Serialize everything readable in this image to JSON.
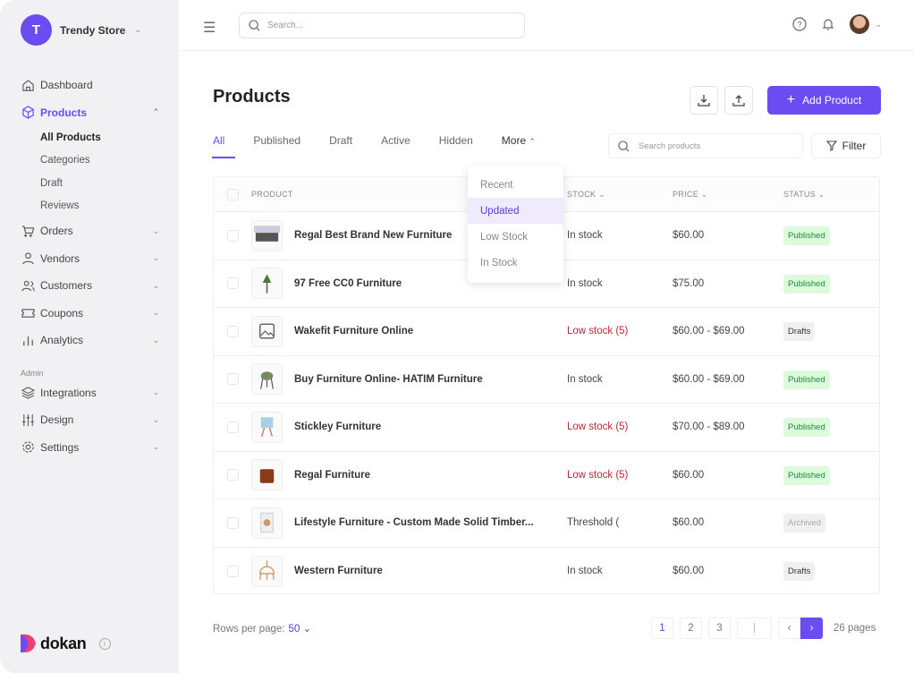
{
  "colors": {
    "accent": "#6a4cf0",
    "sidebar_bg": "#f1f1f4",
    "low_stock": "#b42a3c",
    "published_bg": "#dcfadc"
  },
  "store": {
    "initial": "T",
    "name": "Trendy Store"
  },
  "sidebar": {
    "items": [
      {
        "label": "Dashboard",
        "icon": "home-icon"
      },
      {
        "label": "Products",
        "icon": "box-icon",
        "active": true
      }
    ],
    "sub_items": [
      {
        "label": "All Products",
        "active": true
      },
      {
        "label": "Categories"
      },
      {
        "label": "Draft"
      },
      {
        "label": "Reviews"
      }
    ],
    "more_items": [
      {
        "label": "Orders",
        "icon": "cart-icon"
      },
      {
        "label": "Vendors",
        "icon": "user-icon"
      },
      {
        "label": "Customers",
        "icon": "users-icon"
      },
      {
        "label": "Coupons",
        "icon": "ticket-icon"
      },
      {
        "label": "Analytics",
        "icon": "bar-chart-icon"
      }
    ],
    "admin_label": "Admin",
    "admin_items": [
      {
        "label": "Integrations",
        "icon": "layers-icon"
      },
      {
        "label": "Design",
        "icon": "sliders-icon"
      },
      {
        "label": "Settings",
        "icon": "gear-icon"
      }
    ],
    "logo": "dokan"
  },
  "topbar": {
    "search_placeholder": "Search..."
  },
  "page": {
    "title": "Products",
    "add_label": "Add Product"
  },
  "tabs": [
    "All",
    "Published",
    "Draft",
    "Active",
    "Hidden",
    "More"
  ],
  "product_search_placeholder": "Search products",
  "filter_label": "Filter",
  "more_menu": {
    "items": [
      "Recent",
      "Updated",
      "Low Stock",
      "In Stock"
    ],
    "selected": "Updated"
  },
  "table": {
    "headers": {
      "product": "PRODUCT",
      "stock": "STOCK",
      "price": "PRICE",
      "status": "STATUS"
    },
    "rows": [
      {
        "name": "Regal Best Brand New Furniture",
        "stock": "In stock",
        "low": false,
        "price": "$60.00",
        "status": "Published"
      },
      {
        "name": "97 Free CC0 Furniture",
        "stock": "In stock",
        "low": false,
        "price": "$75.00",
        "status": "Published"
      },
      {
        "name": "Wakefit Furniture Online",
        "stock": "Low stock (5)",
        "low": true,
        "price": "$60.00 - $69.00",
        "status": "Drafts"
      },
      {
        "name": "Buy Furniture Online- HATIM Furniture",
        "stock": "In stock",
        "low": false,
        "price": "$60.00 - $69.00",
        "status": "Published"
      },
      {
        "name": "Stickley Furniture",
        "stock": "Low stock (5)",
        "low": true,
        "price": "$70.00 - $89.00",
        "status": "Published"
      },
      {
        "name": "Regal Furniture",
        "stock": "Low stock (5)",
        "low": true,
        "price": "$60.00",
        "status": "Published"
      },
      {
        "name": "Lifestyle Furniture - Custom Made Solid Timber...",
        "stock": "Threshold (",
        "low": false,
        "price": "$60.00",
        "status": "Archived"
      },
      {
        "name": "Western Furniture",
        "stock": "In stock",
        "low": false,
        "price": "$60.00",
        "status": "Drafts"
      }
    ]
  },
  "pagination": {
    "rows_label": "Rows per page:",
    "rows_value": "50",
    "pages": [
      "1",
      "2",
      "3"
    ],
    "current": "1",
    "input_value": "|",
    "total_label": "26 pages"
  }
}
